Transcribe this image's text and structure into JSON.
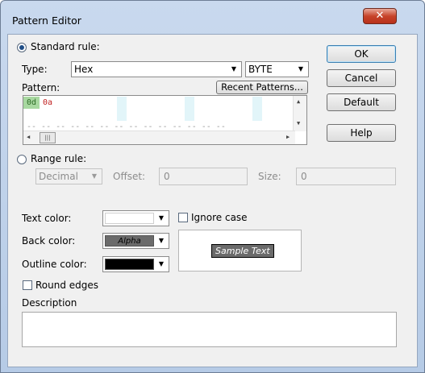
{
  "window": {
    "title": "Pattern Editor",
    "close_glyph": "✕"
  },
  "standard_rule": {
    "label": "Standard rule:",
    "selected": true
  },
  "type": {
    "label": "Type:",
    "value": "Hex",
    "unit_value": "BYTE"
  },
  "pattern": {
    "label": "Pattern:",
    "recent_button": "Recent Patterns...",
    "cells": [
      "0d",
      "0a"
    ],
    "placeholder_row1": "-- -- -- -- -- -- -- -- -- -- -- -- --",
    "placeholder_row2": "-- -- -- -- -- -- -- -- -- -- -- -- -- --",
    "hscroll_thumb": "|||"
  },
  "range_rule": {
    "label": "Range rule:",
    "selected": false,
    "format_value": "Decimal",
    "offset_label": "Offset:",
    "offset_value": "0",
    "size_label": "Size:",
    "size_value": "0"
  },
  "colors": {
    "text_color_label": "Text color:",
    "text_color": "#ffffff",
    "back_color_label": "Back color:",
    "back_color": "#6b6b6b",
    "back_color_swatch_text": "Alpha",
    "outline_color_label": "Outline color:",
    "outline_color": "#000000"
  },
  "ignore_case": {
    "label": "Ignore case",
    "checked": false
  },
  "sample_text": "Sample Text",
  "round_edges": {
    "label": "Round edges",
    "checked": false
  },
  "description": {
    "label": "Description",
    "value": ""
  },
  "buttons": {
    "ok": "OK",
    "cancel": "Cancel",
    "default": "Default",
    "help": "Help"
  },
  "icons": {
    "dropdown": "▼",
    "scroll_up": "▲",
    "scroll_down": "▼",
    "scroll_left": "◀",
    "scroll_right": "▶"
  }
}
